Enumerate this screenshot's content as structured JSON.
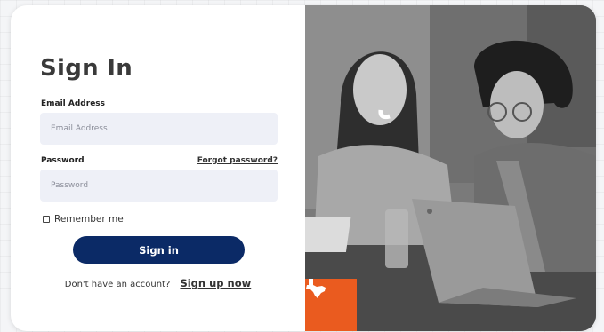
{
  "form": {
    "title": "Sign In",
    "email": {
      "label": "Email Address",
      "placeholder": "Email Address",
      "value": ""
    },
    "password": {
      "label": "Password",
      "placeholder": "Password",
      "value": "",
      "forgot_link": "Forgot password?"
    },
    "remember_me": {
      "label": "Remember me",
      "checked": false
    },
    "submit_label": "Sign in",
    "signup": {
      "prompt": "Don't have an account?",
      "link": "Sign up now"
    }
  },
  "photo": {
    "icon": "texas-state-icon",
    "badge_color": "#ea5b1f"
  },
  "colors": {
    "primary_button": "#0b2a66",
    "input_background": "#eef0f7",
    "badge": "#ea5b1f"
  }
}
